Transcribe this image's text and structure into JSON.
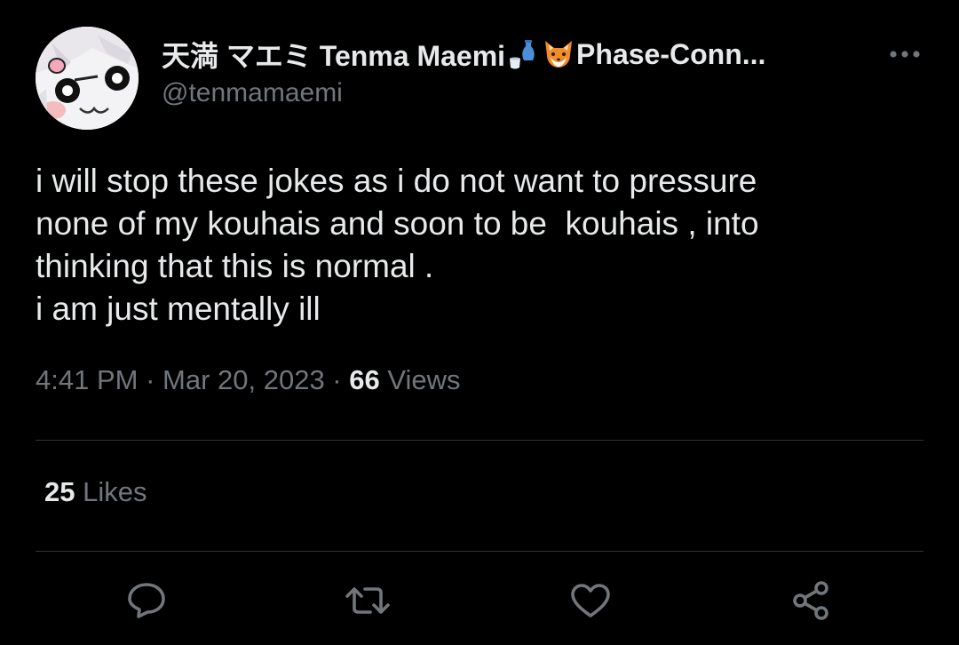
{
  "tweet": {
    "author": {
      "display_name": "天満 マエミ Tenma Maemi",
      "name_emojis": [
        "sake-icon",
        "fox-icon"
      ],
      "name_tail": "Phase-Conn...",
      "handle": "@tenmamaemi",
      "avatar": "avatar"
    },
    "text_lines": [
      "i will stop these jokes as i do not want to pressure",
      "none of my kouhais and soon to be  kouhais , into",
      "thinking that this is normal .",
      "i am just mentally ill"
    ],
    "meta": {
      "time": "4:41 PM",
      "separator": " · ",
      "date": "Mar 20, 2023",
      "views_count": "66",
      "views_label": " Views"
    },
    "stats": {
      "likes_count": "25",
      "likes_label": " Likes"
    },
    "actions": [
      "reply-icon",
      "retweet-icon",
      "like-icon",
      "share-icon"
    ],
    "more_icon": "more-icon"
  },
  "colors": {
    "background": "#000000",
    "text_primary": "#e7e9ea",
    "text_secondary": "#71767b",
    "divider": "#2f3336",
    "icon": "#71767b"
  }
}
